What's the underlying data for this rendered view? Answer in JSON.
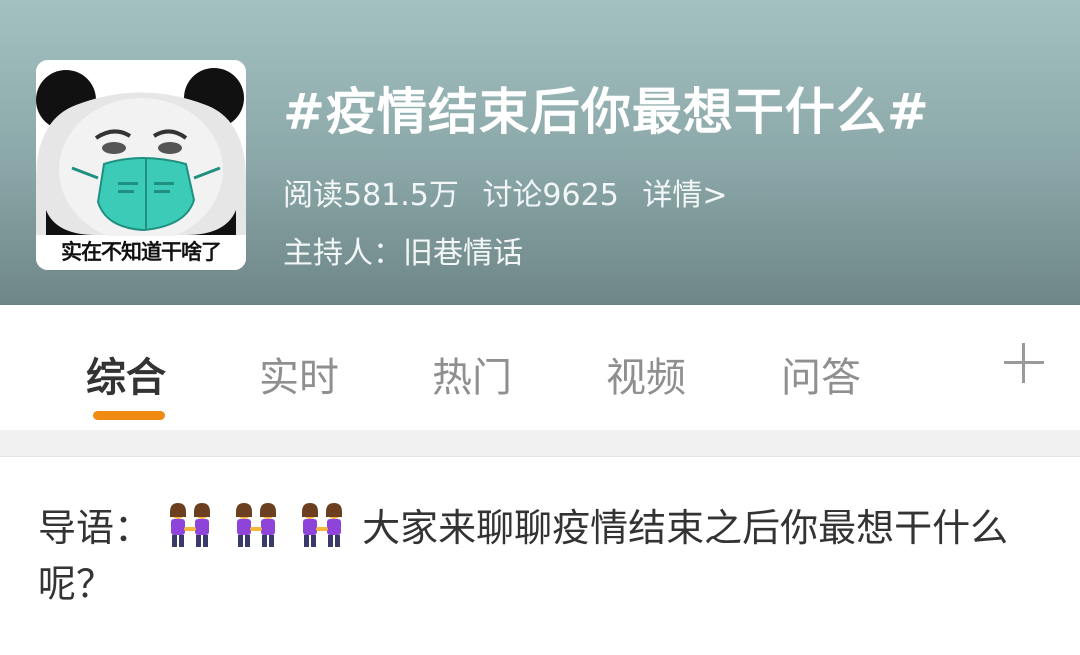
{
  "topic": {
    "thumbnail_caption": "实在不知道干啥了",
    "title": "#疫情结束后你最想干什么#",
    "reads": "阅读581.5万",
    "discussions": "讨论9625",
    "details_link": "详情>",
    "host": "主持人：旧巷情话"
  },
  "tabs": [
    {
      "label": "综合",
      "active": true
    },
    {
      "label": "实时",
      "active": false
    },
    {
      "label": "热门",
      "active": false
    },
    {
      "label": "视频",
      "active": false
    },
    {
      "label": "问答",
      "active": false
    }
  ],
  "tab_add_icon": "plus-icon",
  "intro": {
    "prefix": "导语：",
    "emoji": "two-women-holding-hands-emoji",
    "emoji_count": 3,
    "text": "大家来聊聊疫情结束之后你最想干什么呢？"
  },
  "colors": {
    "tab_indicator": "#f08a12",
    "header_bg": "#8aa6a7"
  }
}
